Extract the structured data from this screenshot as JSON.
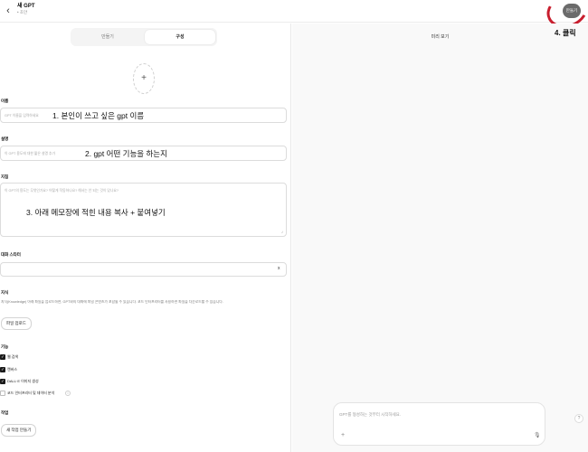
{
  "header": {
    "back_icon": "chevron-left-icon",
    "title": "새 GPT",
    "status": "• 초안",
    "create_button": "만들기"
  },
  "tabs": {
    "make": "만들기",
    "configure": "구성"
  },
  "avatar_upload": {
    "icon": "plus-icon",
    "glyph": "+"
  },
  "fields": {
    "name": {
      "label": "이름",
      "placeholder": "GPT 이름을 입력하세요",
      "annotation": "1. 본인이 쓰고 싶은 gpt 이름"
    },
    "description": {
      "label": "설명",
      "placeholder": "이 GPT 용도에 대한 짧은 설명 추가",
      "annotation": "2. gpt 어떤 기능을 하는지"
    },
    "instructions": {
      "label": "지침",
      "placeholder": "이 GPT의 용도는 무엇인가요? 어떻게 작동하나요? 해서는 안 되는 것이 있나요?",
      "annotation": "3. 아래 메모장에 적힌 내용 복사 + 붙여넣기"
    },
    "starters": {
      "label": "대화 스타터",
      "clear": "x"
    }
  },
  "knowledge": {
    "label": "지식",
    "description": "지식(Knowledge) 아래 파일을 업로드하면, GPT와의 대화에 파일 콘텐츠가 포함될 수 있습니다. 코드 인터프리터를 사용하면 파일을 다운로드할 수 있습니다.",
    "upload_button": "파일 업로드"
  },
  "capabilities": {
    "label": "기능",
    "items": [
      {
        "label": "웹 검색",
        "checked": true
      },
      {
        "label": "캔버스",
        "checked": true
      },
      {
        "label": "DALL·E 이미지 생성",
        "checked": true
      },
      {
        "label": "코드 인터프리터 및 데이터 분석",
        "checked": false
      }
    ],
    "info_icon": "i"
  },
  "actions": {
    "label": "작업",
    "button": "새 작업 만들기"
  },
  "preview": {
    "title": "미리 보기",
    "click_note": "4. 클릭",
    "composer_placeholder": "GPT를 형성하는 것부터 시작하세요.",
    "plus": "+",
    "mic": "🎙",
    "help": "?"
  },
  "colors": {
    "accent_ring": "#c81e2e",
    "create_button_bg": "#6b6b6b"
  }
}
